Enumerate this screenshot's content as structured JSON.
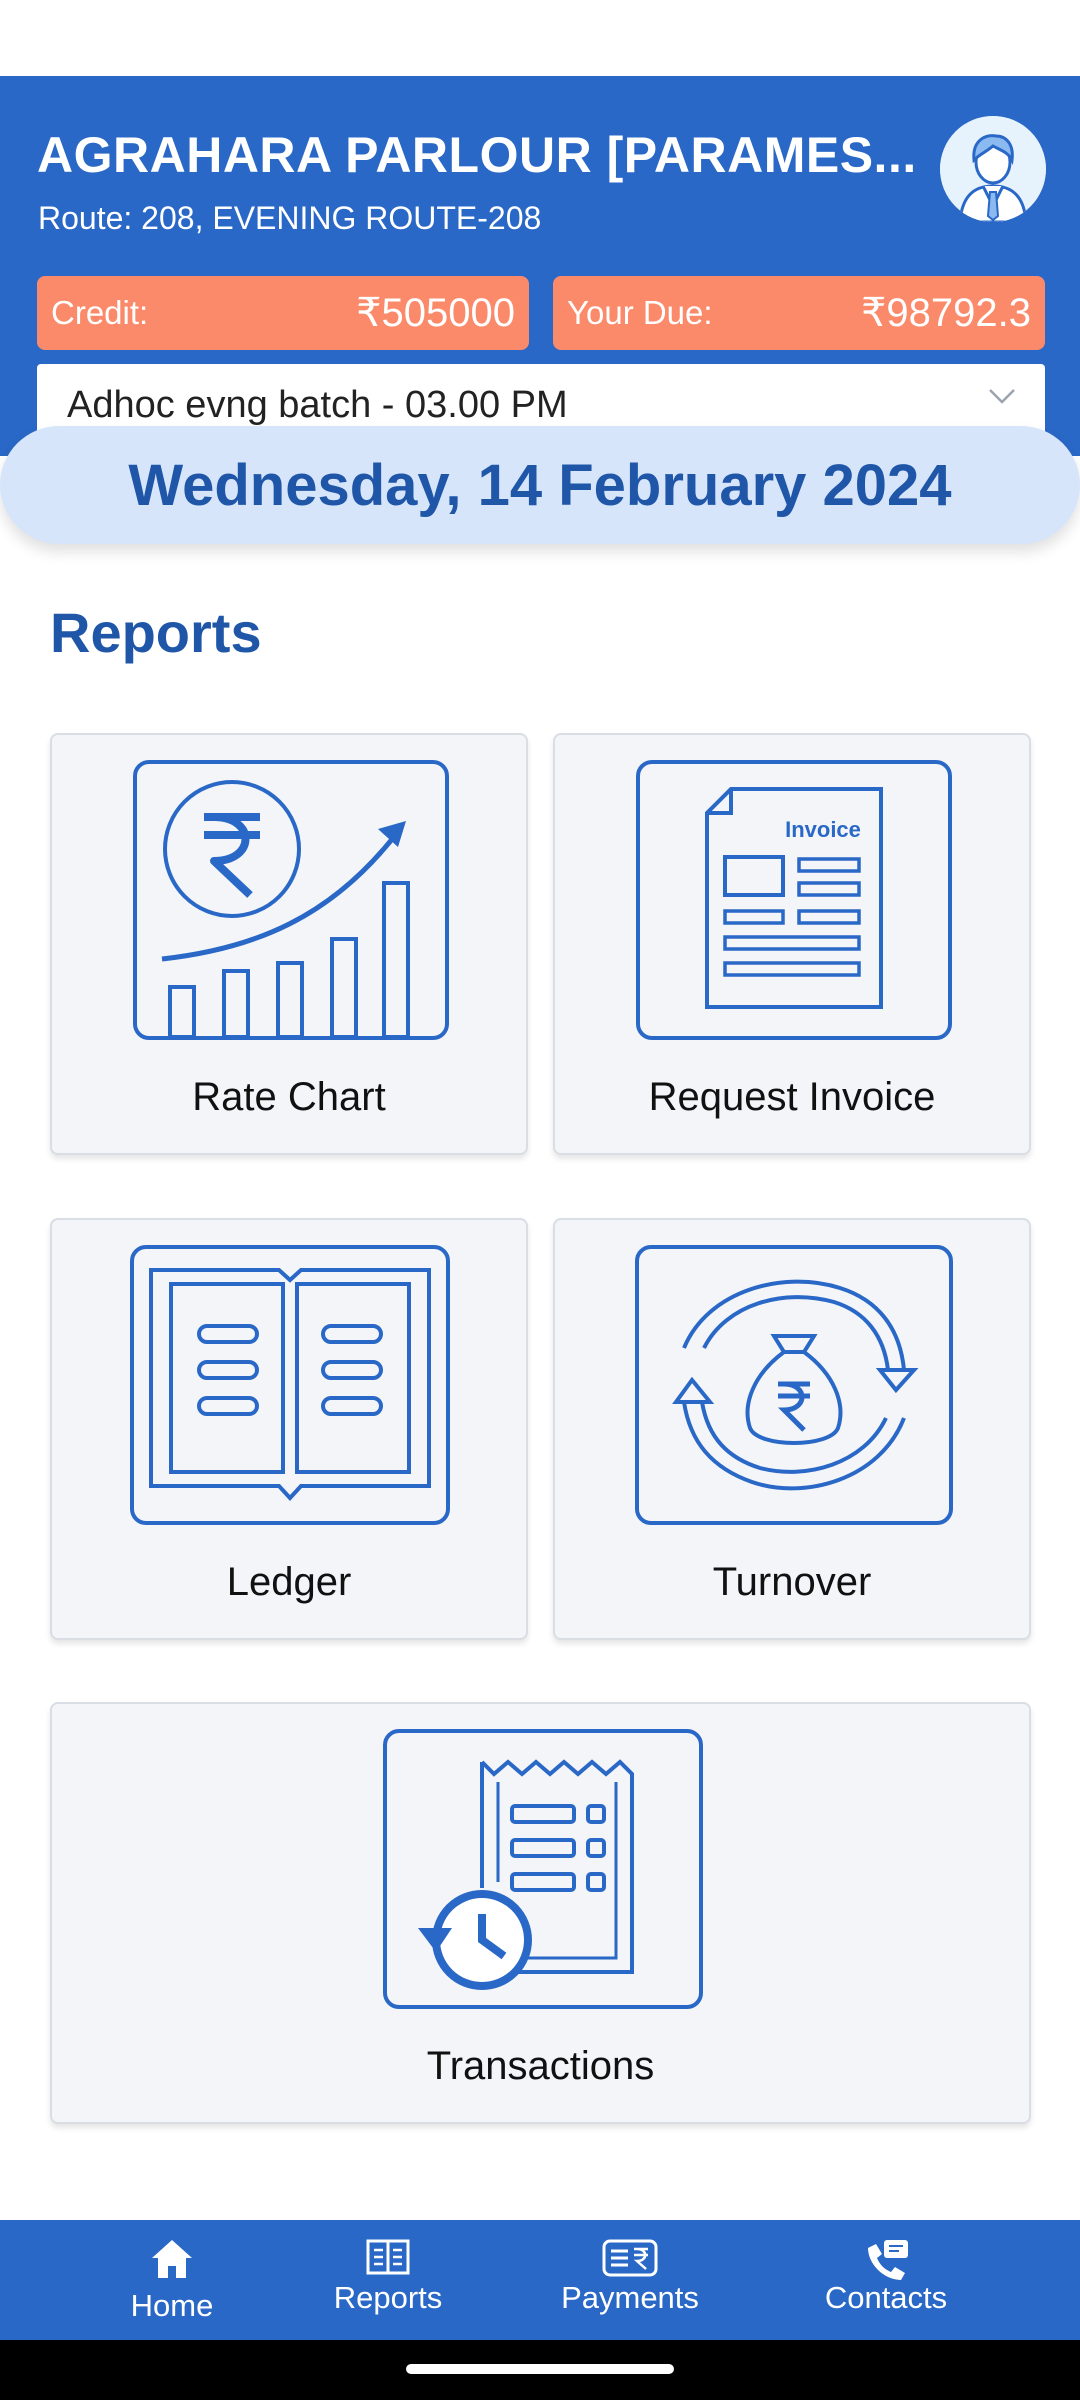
{
  "header": {
    "title": "AGRAHARA PARLOUR [PARAMES...",
    "route": "Route: 208, EVENING ROUTE-208",
    "credit_label": "Credit:",
    "credit_value": "₹505000",
    "due_label": "Your Due:",
    "due_value": "₹98792.3",
    "batch_selected": "Adhoc evng batch - 03.00 PM"
  },
  "date_banner": "Wednesday, 14 February 2024",
  "reports": {
    "title": "Reports",
    "tiles": [
      {
        "label": "Rate Chart"
      },
      {
        "label": "Request Invoice",
        "icon_text": "Invoice"
      },
      {
        "label": "Ledger"
      },
      {
        "label": "Turnover"
      },
      {
        "label": "Transactions"
      }
    ]
  },
  "bottom_nav": [
    {
      "label": "Home",
      "icon": "home-icon"
    },
    {
      "label": "Reports",
      "icon": "book-icon"
    },
    {
      "label": "Payments",
      "icon": "payment-icon"
    },
    {
      "label": "Contacts",
      "icon": "phone-icon"
    }
  ],
  "colors": {
    "primary": "#2a68c7",
    "accent": "#fb8a6a",
    "banner": "#d7e5fb",
    "icon": "#2a68c7"
  }
}
